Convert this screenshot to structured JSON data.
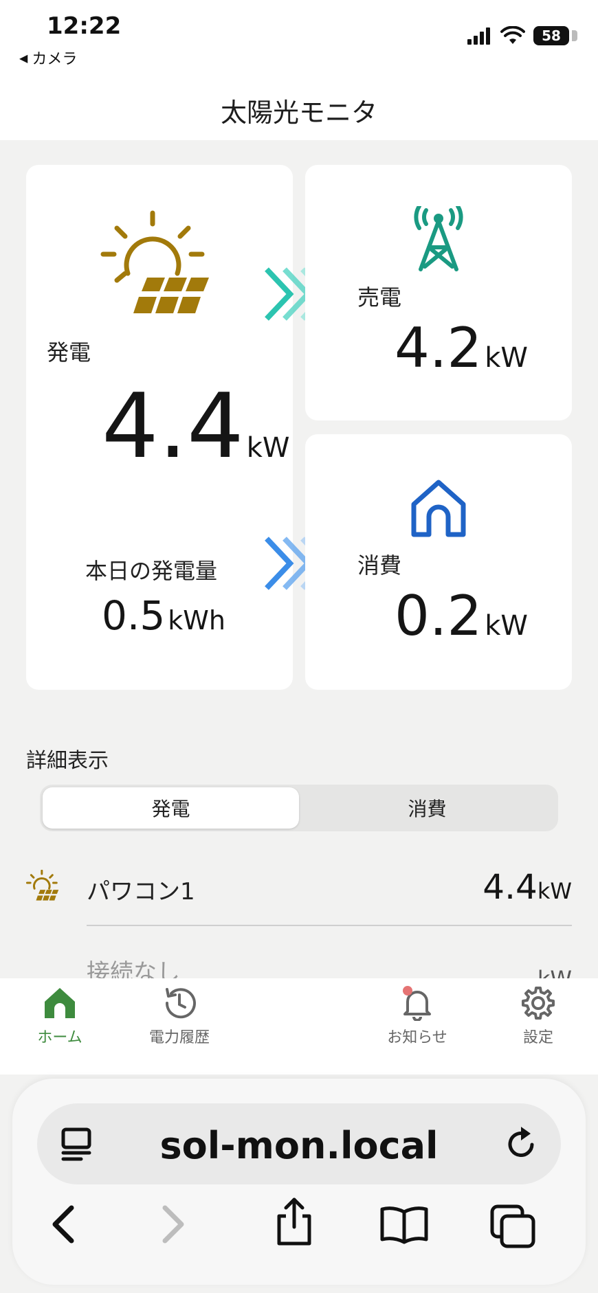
{
  "status": {
    "time": "12:22",
    "back_app": "カメラ",
    "battery": "58"
  },
  "header": {
    "title": "太陽光モニタ"
  },
  "generation": {
    "label": "発電",
    "value": "4.4",
    "unit": "kW",
    "today_label": "本日の発電量",
    "today_value": "0.5",
    "today_unit": "kWh"
  },
  "sell": {
    "label": "売電",
    "value": "4.2",
    "unit": "kW"
  },
  "consumption": {
    "label": "消費",
    "value": "0.2",
    "unit": "kW"
  },
  "detail": {
    "title": "詳細表示",
    "tabs": [
      "発電",
      "消費"
    ],
    "rows": [
      {
        "label": "パワコン1",
        "value": "4.4",
        "unit": "kW"
      },
      {
        "label": "接続なし",
        "value": "",
        "unit": "kW"
      }
    ]
  },
  "tabbar": {
    "items": [
      {
        "label": "ホーム",
        "icon": "home-icon"
      },
      {
        "label": "電力履歴",
        "icon": "history-icon"
      },
      {
        "label": "お知らせ",
        "icon": "bell-icon"
      },
      {
        "label": "設定",
        "icon": "gear-icon"
      }
    ]
  },
  "browser": {
    "url": "sol-mon.local"
  },
  "colors": {
    "solar": "#a27a0b",
    "tower": "#1a9a82",
    "home": "#1f63c6",
    "chevron_teal": "#2cc4b0",
    "chevron_blue": "#3b8de8",
    "active_tab": "#3e8b3e"
  }
}
